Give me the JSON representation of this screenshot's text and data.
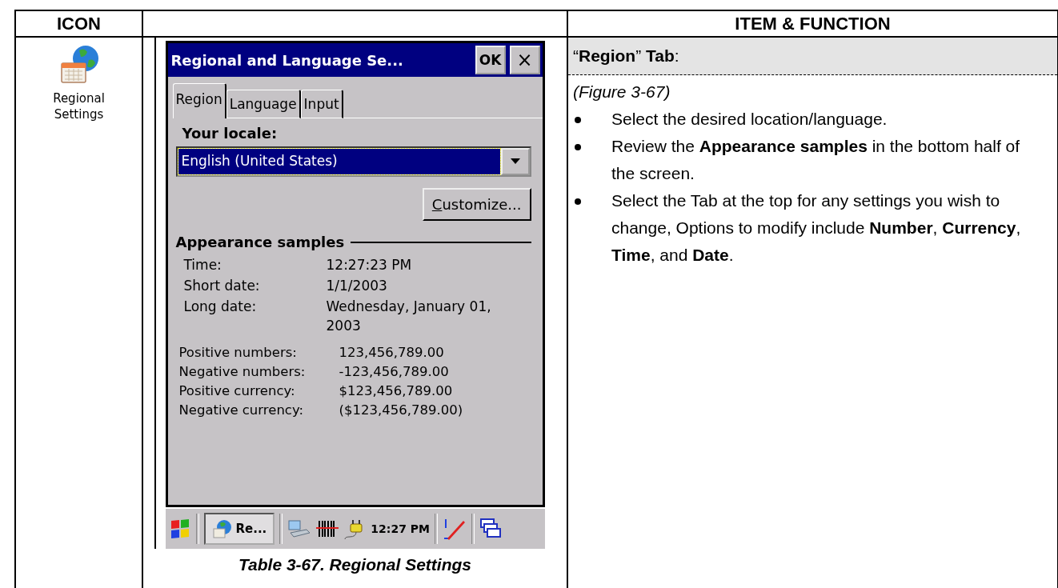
{
  "table": {
    "columns": [
      {
        "heading": "ICON"
      },
      {
        "heading": "ITEM & FUNCTION"
      }
    ]
  },
  "icon_cell": {
    "label": "Regional Settings"
  },
  "screenshot": {
    "window": {
      "title": "Regional and Language Se...",
      "ok_button": "OK",
      "close_button": "×"
    },
    "tabs": [
      {
        "label": "Region",
        "selected": true
      },
      {
        "label": "Language",
        "selected": false
      },
      {
        "label": "Input",
        "selected": false
      }
    ],
    "locale_label": "Your locale:",
    "locale_value": "English (United States)",
    "customize_button": "Customize...",
    "samples_heading": "Appearance samples",
    "date_samples": [
      {
        "label": "Time:",
        "value": "12:27:23 PM"
      },
      {
        "label": "Short date:",
        "value": "1/1/2003"
      },
      {
        "label": "Long date:",
        "value": "Wednesday, January 01, 2003"
      }
    ],
    "number_samples": [
      {
        "label": "Positive numbers:",
        "value": "123,456,789.00"
      },
      {
        "label": "Negative numbers:",
        "value": "-123,456,789.00"
      },
      {
        "label": "Positive currency:",
        "value": "$123,456,789.00"
      },
      {
        "label": "Negative currency:",
        "value": "($123,456,789.00)"
      }
    ],
    "taskbar": {
      "task_button": "Re...",
      "clock": "12:27 PM"
    }
  },
  "caption": "Table 3-67. Regional Settings",
  "item": {
    "heading": "“**Region**” **Tab**:",
    "figure_ref": "(Figure 3-67)",
    "bullets": [
      "Select the desired location/language.",
      "Review the **Appearance samples** in the bottom half of the screen.",
      "Select the Tab at the top for any settings you wish to change, Options to modify include **Number**, **Currency**, **Time**, and **Date**."
    ]
  }
}
